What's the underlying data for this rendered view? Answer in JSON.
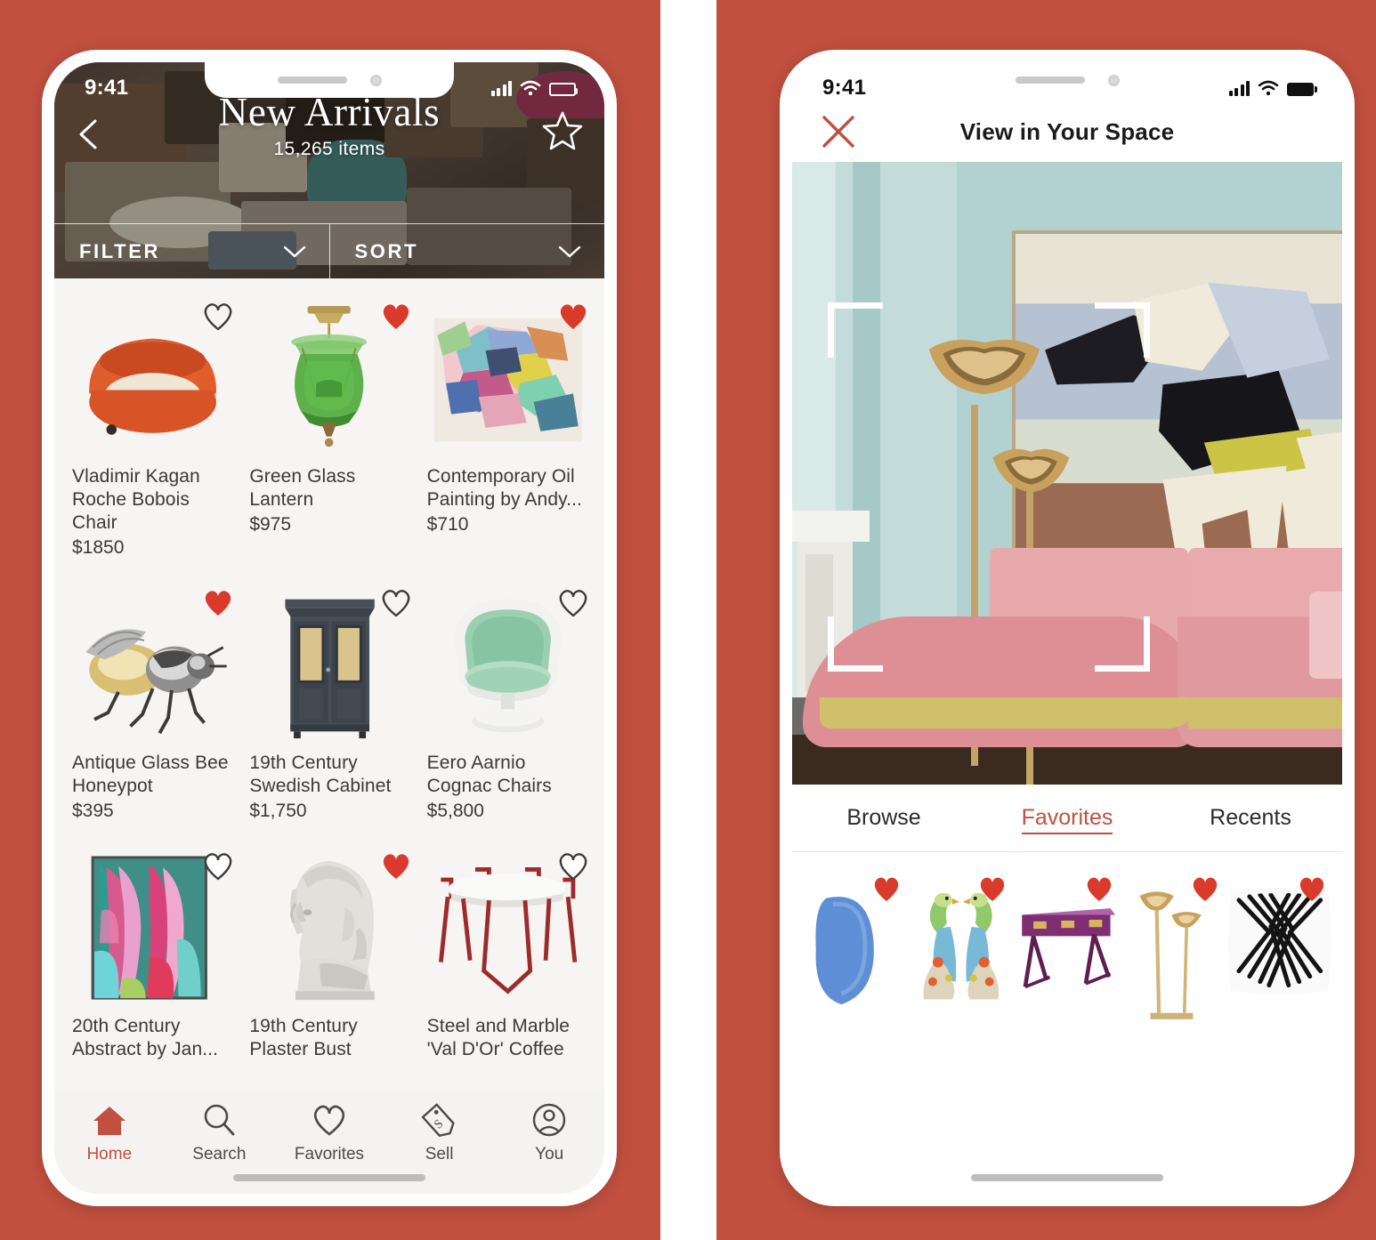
{
  "background": {
    "accent_red": "#C1503F",
    "screen_bg": "#F6F5F3"
  },
  "left_phone": {
    "status_bar": {
      "time": "9:41",
      "signal_icon": "cellular-bars-icon",
      "wifi_icon": "wifi-icon",
      "battery_icon": "battery-icon"
    },
    "hero": {
      "title": "New Arrivals",
      "subtitle": "15,265 items",
      "back_icon": "chevron-left-icon",
      "favorite_icon": "star-outline-icon"
    },
    "controls": [
      {
        "label": "FILTER",
        "icon": "chevron-down-icon"
      },
      {
        "label": "SORT",
        "icon": "chevron-down-icon"
      }
    ],
    "products": [
      {
        "name": "Vladimir Kagan\nRoche Bobois Chair",
        "price": "$1850",
        "favorited": false,
        "art": "orange-swivel-chair"
      },
      {
        "name": "Green Glass\nLantern",
        "price": "$975",
        "favorited": true,
        "art": "green-glass-lantern"
      },
      {
        "name": "Contemporary Oil\nPainting by Andy...",
        "price": "$710",
        "favorited": true,
        "art": "abstract-oil-painting"
      },
      {
        "name": "Antique Glass Bee\nHoneypot",
        "price": "$395",
        "favorited": true,
        "art": "silver-bee-honeypot"
      },
      {
        "name": "19th Century\nSwedish Cabinet",
        "price": "$1,750",
        "favorited": false,
        "art": "dark-swedish-cabinet"
      },
      {
        "name": "Eero Aarnio\nCognac Chairs",
        "price": "$5,800",
        "favorited": false,
        "art": "green-cognac-chair"
      },
      {
        "name": "20th Century\nAbstract by Jan...",
        "price": "",
        "favorited": false,
        "art": "pink-teal-abstract"
      },
      {
        "name": "19th Century\nPlaster Bust",
        "price": "",
        "favorited": true,
        "art": "plaster-bust"
      },
      {
        "name": "Steel and Marble\n'Val D'Or' Coffee",
        "price": "",
        "favorited": false,
        "art": "red-steel-marble-table"
      }
    ],
    "tabs": [
      {
        "label": "Home",
        "icon": "home-icon",
        "active": true
      },
      {
        "label": "Search",
        "icon": "magnifier-icon",
        "active": false
      },
      {
        "label": "Favorites",
        "icon": "heart-outline-icon",
        "active": false
      },
      {
        "label": "Sell",
        "icon": "price-tag-icon",
        "active": false
      },
      {
        "label": "You",
        "icon": "person-circle-icon",
        "active": false
      }
    ]
  },
  "right_phone": {
    "status_bar": {
      "time": "9:41",
      "signal_icon": "cellular-bars-icon",
      "wifi_icon": "wifi-icon",
      "battery_icon": "battery-icon"
    },
    "header": {
      "title": "View in Your Space",
      "close_icon": "close-x-icon"
    },
    "ar_scene": {
      "description": "pink velvet curved sofa with gold base in mint-green room with brass flower floor lamps and abstract artwork",
      "bracket_icon": "ar-corner-bracket"
    },
    "tabs": [
      {
        "label": "Browse",
        "active": false
      },
      {
        "label": "Favorites",
        "active": true
      },
      {
        "label": "Recents",
        "active": false
      }
    ],
    "favorites": [
      {
        "art": "blue-blob-object",
        "favorited": true
      },
      {
        "art": "parrot-figurines",
        "favorited": true
      },
      {
        "art": "purple-desk",
        "favorited": true
      },
      {
        "art": "brass-floor-lamp",
        "favorited": true
      },
      {
        "art": "zebra-pillow",
        "favorited": true
      }
    ]
  }
}
